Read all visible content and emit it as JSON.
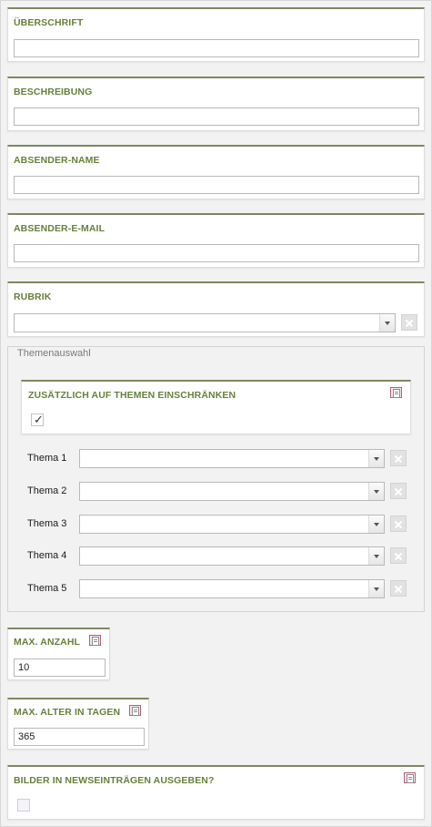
{
  "fields": {
    "ueberschrift": {
      "label": "ÜBERSCHRIFT",
      "value": ""
    },
    "beschreibung": {
      "label": "BESCHREIBUNG",
      "value": ""
    },
    "absender_name": {
      "label": "ABSENDER-NAME",
      "value": ""
    },
    "absender_email": {
      "label": "ABSENDER-E-MAIL",
      "value": ""
    },
    "rubrik": {
      "label": "RUBRIK",
      "selected": ""
    }
  },
  "themen": {
    "legend": "Themenauswahl",
    "restrict_label": "ZUSÄTZLICH AUF THEMEN EINSCHRÄNKEN",
    "restrict_checked": true,
    "rows": [
      {
        "label": "Thema 1",
        "selected": ""
      },
      {
        "label": "Thema 2",
        "selected": ""
      },
      {
        "label": "Thema 3",
        "selected": ""
      },
      {
        "label": "Thema 4",
        "selected": ""
      },
      {
        "label": "Thema 5",
        "selected": ""
      }
    ]
  },
  "max_anzahl": {
    "label": "MAX. ANZAHL",
    "value": "10"
  },
  "max_alter": {
    "label": "MAX. ALTER IN TAGEN",
    "value": "365"
  },
  "bilder": {
    "label": "BILDER IN NEWSEINTRÄGEN AUSGEBEN?",
    "checked": false
  },
  "icons": {
    "help": "help-document-icon",
    "clear": "clear-x-icon",
    "dropdown": "chevron-down-icon",
    "check": "checkmark-icon"
  },
  "colors": {
    "label": "#69803c",
    "panel_top_border": "#7d8862",
    "help_icon": "#b4627e"
  }
}
